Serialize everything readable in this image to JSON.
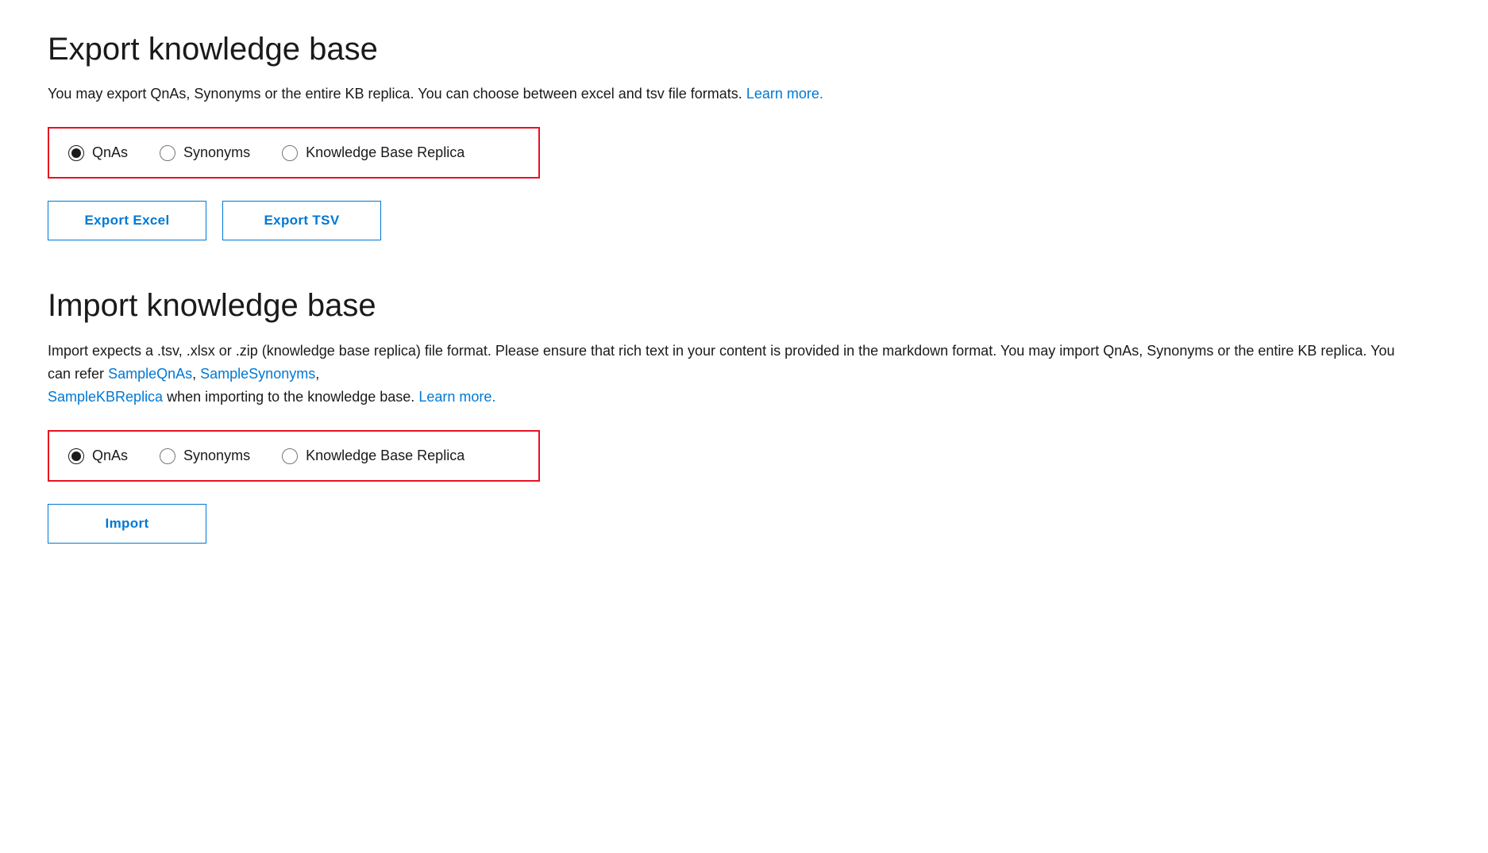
{
  "export_section": {
    "title": "Export knowledge base",
    "description_text": "You may export QnAs, Synonyms or the entire KB replica. You can choose between excel and tsv file formats.",
    "description_link_text": "Learn more.",
    "radio_group": {
      "options": [
        {
          "id": "export-qnas",
          "label": "QnAs",
          "checked": true
        },
        {
          "id": "export-synonyms",
          "label": "Synonyms",
          "checked": false
        },
        {
          "id": "export-kb-replica",
          "label": "Knowledge Base Replica",
          "checked": false
        }
      ]
    },
    "buttons": [
      {
        "id": "export-excel",
        "label": "Export Excel"
      },
      {
        "id": "export-tsv",
        "label": "Export TSV"
      }
    ]
  },
  "import_section": {
    "title": "Import knowledge base",
    "description_part1": "Import expects a .tsv, .xlsx or .zip (knowledge base replica) file format. Please ensure that rich text in your content is provided in the markdown format. You may import QnAs, Synonyms or the entire KB replica. You can refer",
    "description_link1": "SampleQnAs",
    "description_link2": "SampleSynonyms",
    "description_link3": "SampleKBReplica",
    "description_part2": "when importing to the knowledge base.",
    "description_link4": "Learn more.",
    "radio_group": {
      "options": [
        {
          "id": "import-qnas",
          "label": "QnAs",
          "checked": true
        },
        {
          "id": "import-synonyms",
          "label": "Synonyms",
          "checked": false
        },
        {
          "id": "import-kb-replica",
          "label": "Knowledge Base Replica",
          "checked": false
        }
      ]
    },
    "button": {
      "id": "import-btn",
      "label": "Import"
    }
  }
}
